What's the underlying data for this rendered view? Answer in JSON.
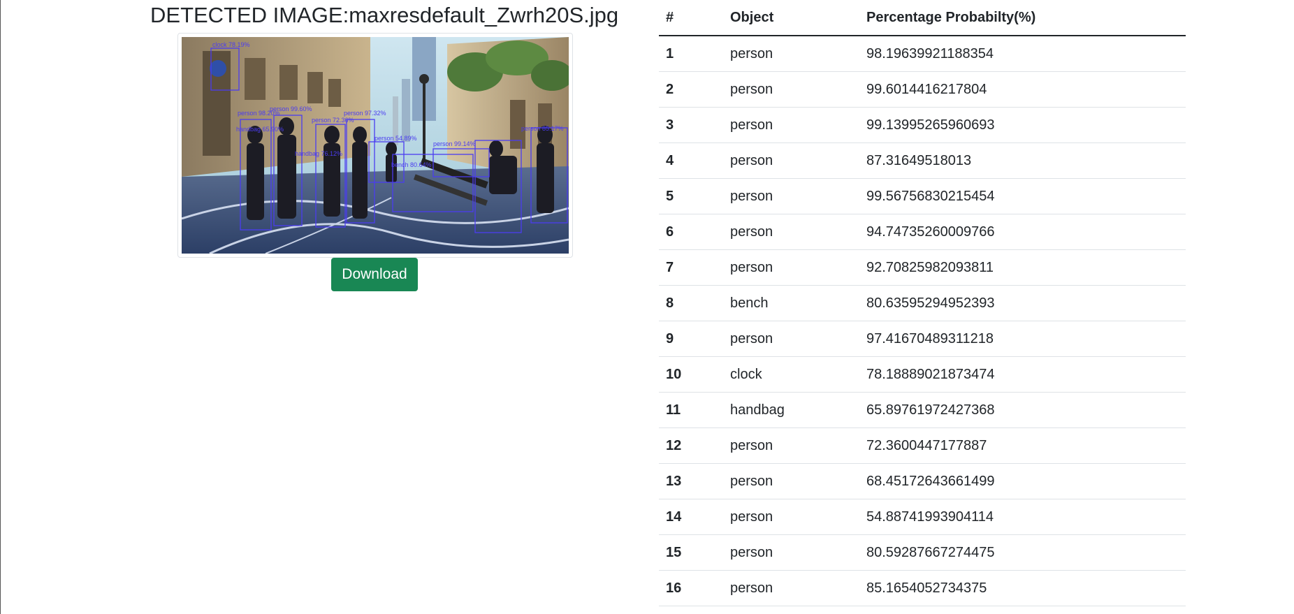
{
  "header": {
    "title": "DETECTED IMAGE:maxresdefault_Zwrh20S.jpg"
  },
  "image": {
    "icon": "detected-street-image",
    "box_color": "#4b3cf0",
    "annotations": [
      "clock 78.19%",
      "handbag 65.90%",
      "person 72.36%",
      "person 97.32%",
      "handbag 76.12%",
      "person 54.89%",
      "bench 80.64%",
      "person 85.17%",
      "person 98.20%",
      "person 99.60%",
      "person 99.14%"
    ]
  },
  "actions": {
    "download_label": "Download"
  },
  "table": {
    "headers": [
      "#",
      "Object",
      "Percentage Probabilty(%)"
    ],
    "rows": [
      {
        "idx": "1",
        "object": "person",
        "prob": "98.19639921188354"
      },
      {
        "idx": "2",
        "object": "person",
        "prob": "99.6014416217804"
      },
      {
        "idx": "3",
        "object": "person",
        "prob": "99.13995265960693"
      },
      {
        "idx": "4",
        "object": "person",
        "prob": "87.31649518013"
      },
      {
        "idx": "5",
        "object": "person",
        "prob": "99.56756830215454"
      },
      {
        "idx": "6",
        "object": "person",
        "prob": "94.74735260009766"
      },
      {
        "idx": "7",
        "object": "person",
        "prob": "92.70825982093811"
      },
      {
        "idx": "8",
        "object": "bench",
        "prob": "80.63595294952393"
      },
      {
        "idx": "9",
        "object": "person",
        "prob": "97.41670489311218"
      },
      {
        "idx": "10",
        "object": "clock",
        "prob": "78.18889021873474"
      },
      {
        "idx": "11",
        "object": "handbag",
        "prob": "65.89761972427368"
      },
      {
        "idx": "12",
        "object": "person",
        "prob": "72.3600447177887"
      },
      {
        "idx": "13",
        "object": "person",
        "prob": "68.45172643661499"
      },
      {
        "idx": "14",
        "object": "person",
        "prob": "54.88741993904114"
      },
      {
        "idx": "15",
        "object": "person",
        "prob": "80.59287667274475"
      },
      {
        "idx": "16",
        "object": "person",
        "prob": "85.1654052734375"
      }
    ]
  }
}
